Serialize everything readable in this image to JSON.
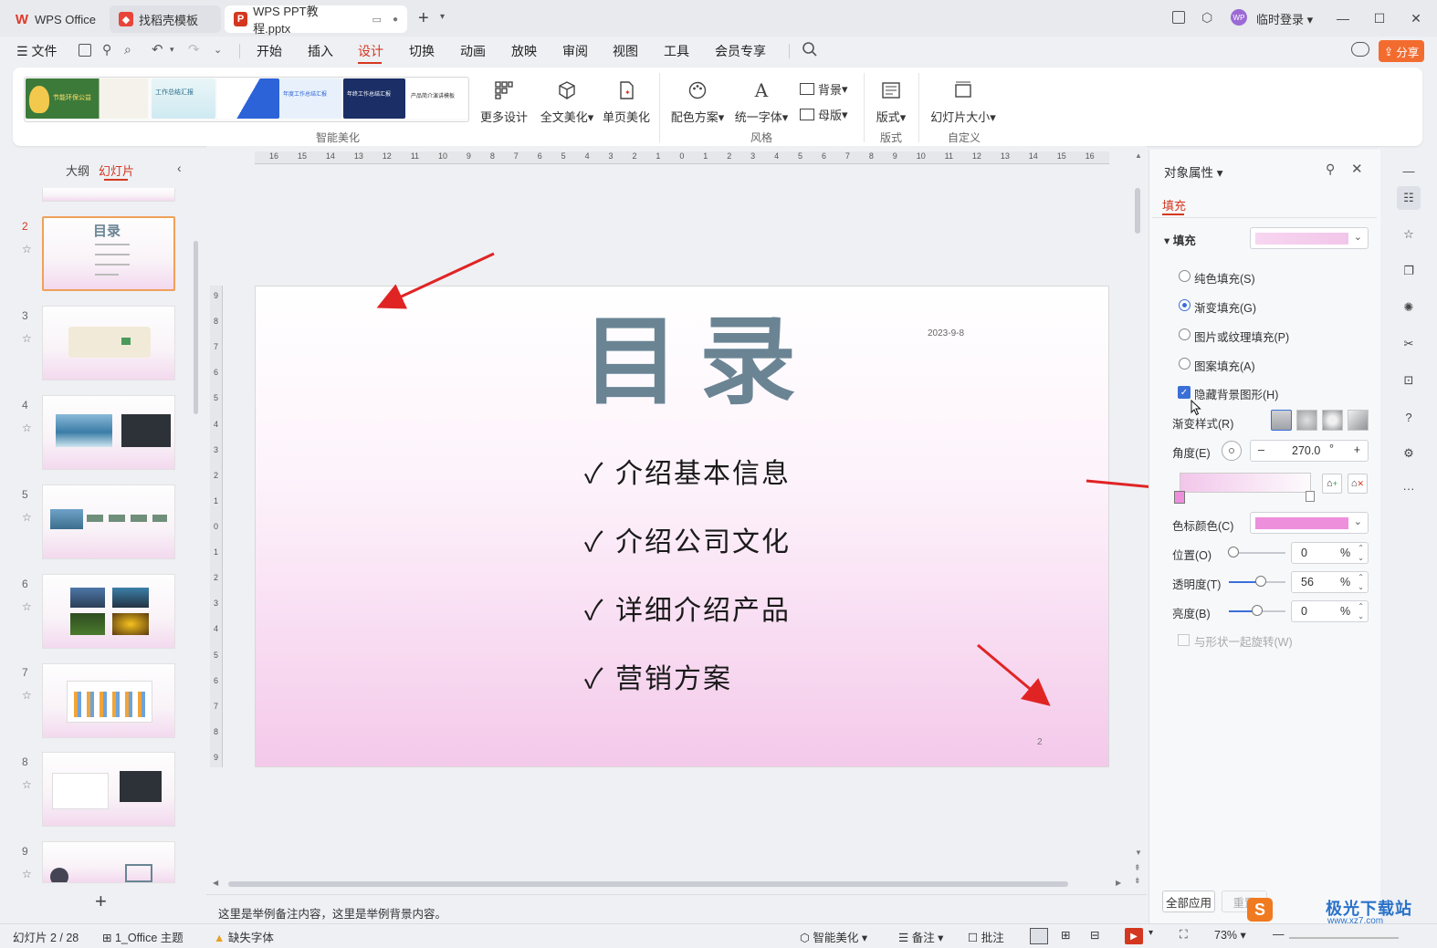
{
  "tabs": [
    {
      "label": "WPS Office"
    },
    {
      "label": "找稻壳模板"
    },
    {
      "label": "WPS PPT教程.pptx"
    }
  ],
  "account": {
    "label": "临时登录",
    "avatar": "WP"
  },
  "menu": {
    "file": "文件",
    "items": [
      "开始",
      "插入",
      "设计",
      "切换",
      "动画",
      "放映",
      "审阅",
      "视图",
      "工具",
      "会员专享"
    ],
    "share": "分享"
  },
  "ribbon": {
    "more_design": "更多设计",
    "full_beautify": "全文美化",
    "page_beautify": "单页美化",
    "color_scheme": "配色方案",
    "unify_font": "统一字体",
    "background": "背景",
    "master": "母版",
    "layout": "版式",
    "slide_size": "幻灯片大小",
    "groups": {
      "smart": "智能美化",
      "style": "风格",
      "layout": "版式",
      "custom": "自定义"
    },
    "theme_thumbs": [
      "节能环保公益",
      "工作总结汇报",
      "年度工作总结汇报",
      "年终工作总结汇报",
      "产品简介演讲模板"
    ]
  },
  "left_panel": {
    "outline_tab": "大纲",
    "slides_tab": "幻灯片",
    "slide_numbers": [
      "2",
      "3",
      "4",
      "5",
      "6",
      "7",
      "8",
      "9"
    ],
    "thumb2_title": "目录"
  },
  "slide": {
    "title": "目录",
    "date": "2023-9-8",
    "page_number": "2",
    "bullets": [
      "介绍基本信息",
      "介绍公司文化",
      "详细介绍产品",
      "营销方案"
    ],
    "check": "✓"
  },
  "ruler_labels": [
    "16",
    "15",
    "14",
    "13",
    "12",
    "11",
    "10",
    "9",
    "8",
    "7",
    "6",
    "5",
    "4",
    "3",
    "2",
    "1",
    "0",
    "1",
    "2",
    "3",
    "4",
    "5",
    "6",
    "7",
    "8",
    "9",
    "10",
    "11",
    "12",
    "13",
    "14",
    "15",
    "16"
  ],
  "vruler_labels": [
    "9",
    "8",
    "7",
    "6",
    "5",
    "4",
    "3",
    "2",
    "1",
    "0",
    "1",
    "2",
    "3",
    "4",
    "5",
    "6",
    "7",
    "8",
    "9"
  ],
  "notes": "这里是举例备注内容，这里是举例背景内容。",
  "properties": {
    "title": "对象属性",
    "tab_fill": "填充",
    "section_fill": "填充",
    "options": [
      "纯色填充(S)",
      "渐变填充(G)",
      "图片或纹理填充(P)",
      "图案填充(A)"
    ],
    "selected_option": 1,
    "hide_bg": "隐藏背景图形(H)",
    "gradient_style": "渐变样式(R)",
    "angle_label": "角度(E)",
    "angle_value": "270.0",
    "angle_unit": "°",
    "stop_color_label": "色标颜色(C)",
    "position_label": "位置(O)",
    "position_value": "0",
    "transparency_label": "透明度(T)",
    "transparency_value": "56",
    "transparency_fraction": 0.56,
    "brightness_label": "亮度(B)",
    "brightness_value": "0",
    "percent": "%",
    "rotate_with_shape": "与形状一起旋转(W)",
    "apply_all": "全部应用",
    "reset": "重置",
    "fill_color": "#f2c6ea",
    "stop_color": "#ee8fdc"
  },
  "status": {
    "slide_info": "幻灯片 2 / 28",
    "theme": "1_Office 主题",
    "missing_font": "缺失字体",
    "smart": "智能美化",
    "notes": "备注",
    "comments": "批注",
    "zoom": "73%"
  },
  "watermark": "极光下载站",
  "watermark_url": "www.xz7.com"
}
